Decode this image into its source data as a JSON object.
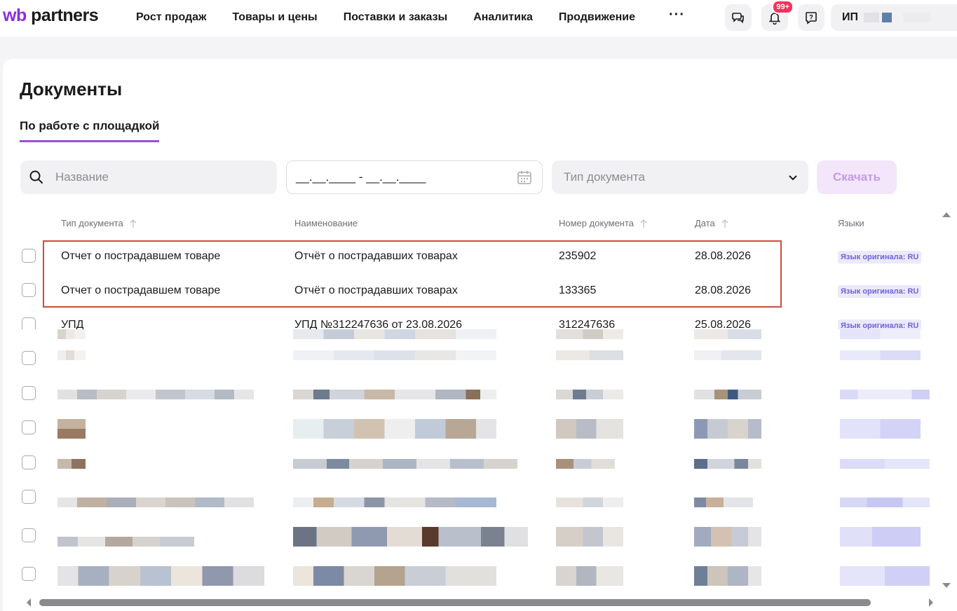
{
  "header": {
    "logo_wb": "wb",
    "logo_rest": " partners",
    "nav": [
      "Рост продаж",
      "Товары и цены",
      "Поставки и заказы",
      "Аналитика",
      "Продвижение"
    ],
    "more": "···",
    "notifications_badge": "99+",
    "account_label": "ИП"
  },
  "page": {
    "title": "Документы",
    "tab": "По работе с площадкой"
  },
  "filters": {
    "search_placeholder": "Название",
    "date_value": "__.__.____ - __.__.____",
    "doc_type_placeholder": "Тип документа",
    "download_label": "Скачать"
  },
  "table": {
    "columns": [
      "Тип документа",
      "Наименование",
      "Номер документа",
      "Дата",
      "Языки"
    ],
    "rows": [
      {
        "type": "Отчет о пострадавшем товаре",
        "name": "Отчёт о пострадавших товарах",
        "number": "235902",
        "date": "28.08.2026",
        "lang": "Язык оригинала: RU"
      },
      {
        "type": "Отчет о пострадавшем товаре",
        "name": "Отчёт о пострадавших товарах",
        "number": "133365",
        "date": "28.08.2026",
        "lang": "Язык оригинала: RU"
      },
      {
        "type": "УПД",
        "name": "УПД №312247636 от 23.08.2026",
        "number": "312247636",
        "date": "25.08.2026",
        "lang": "Язык оригинала: RU"
      }
    ]
  },
  "colors": {
    "accent": "#9a4dde",
    "highlight_border": "#d14a3e",
    "badge": "#f2335a"
  }
}
